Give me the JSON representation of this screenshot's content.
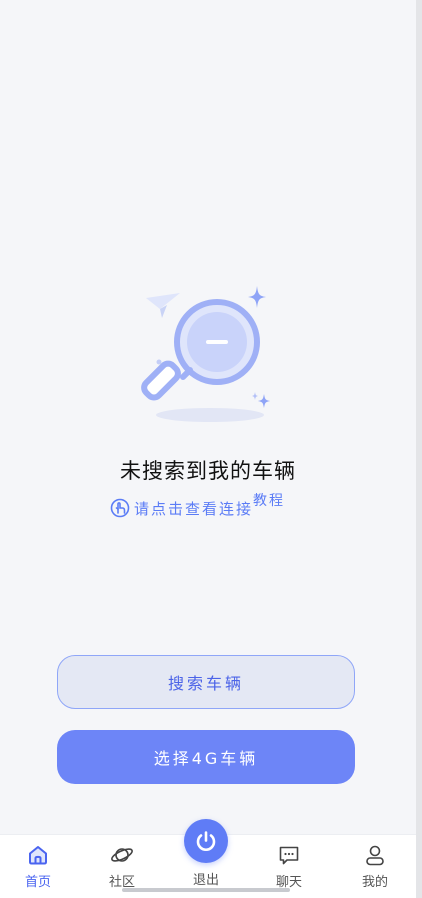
{
  "empty_state": {
    "title": "未搜索到我的车辆",
    "tutorial_link_part1": "请点击查看连接",
    "tutorial_link_part2": "教程"
  },
  "buttons": {
    "search_vehicle": "搜索车辆",
    "select_4g_vehicle": "选择4G车辆"
  },
  "tabbar": {
    "home": "首页",
    "community": "社区",
    "exit": "退出",
    "chat": "聊天",
    "mine": "我的"
  },
  "colors": {
    "accent": "#5f7cf6",
    "background": "#f5f6f9",
    "active_tab": "#4a64f0"
  }
}
